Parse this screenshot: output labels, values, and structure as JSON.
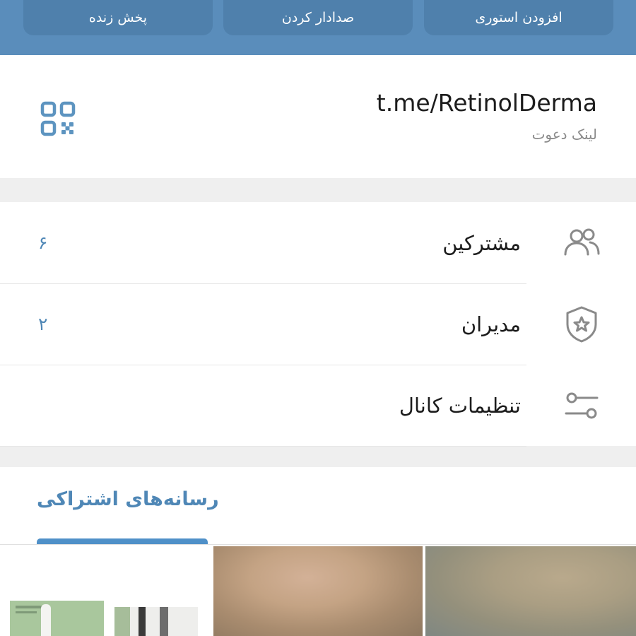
{
  "header": {
    "actions": [
      {
        "label": "پخش زنده",
        "icon": "live-stream"
      },
      {
        "label": "صدادار کردن",
        "icon": "unmute"
      },
      {
        "label": "افزودن استوری",
        "icon": "add-story"
      }
    ],
    "colors": {
      "background": "#5a8dbb",
      "button": "#4f80ac"
    }
  },
  "invite_link": {
    "url": "t.me/RetinolDerma",
    "label": "لینک دعوت",
    "icon": "qr-code-icon"
  },
  "info_rows": [
    {
      "label": "مشترکین",
      "count": "۶",
      "icon": "people-icon"
    },
    {
      "label": "مدیران",
      "count": "۲",
      "icon": "shield-star-icon"
    },
    {
      "label": "تنظیمات کانال",
      "count": "",
      "icon": "sliders-icon"
    }
  ],
  "media": {
    "tab_label": "رسانه‌های اشتراکی",
    "thumbnails": [
      "media-thumb-1",
      "media-thumb-2",
      "media-thumb-3"
    ]
  },
  "accent_color": "#4f87b6"
}
